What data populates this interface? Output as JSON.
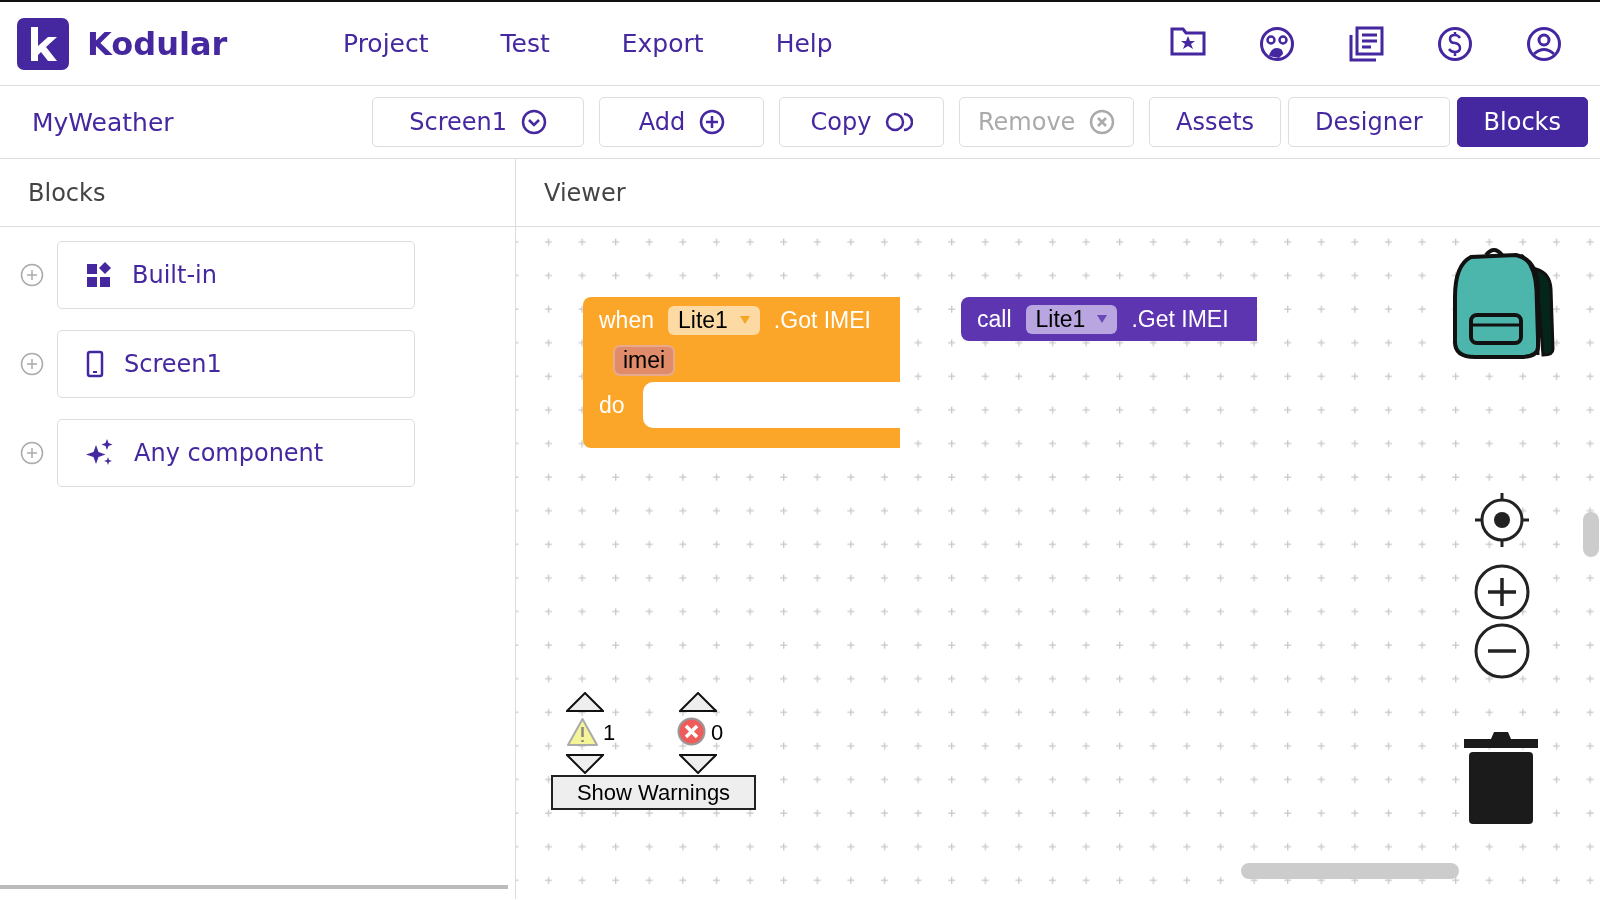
{
  "app": {
    "name": "Kodular"
  },
  "menu": [
    {
      "label": "Project"
    },
    {
      "label": "Test"
    },
    {
      "label": "Export"
    },
    {
      "label": "Help"
    }
  ],
  "project": "MyWeather",
  "actions": [
    {
      "label": "Screen1",
      "kind": "dropdown",
      "disabled": false
    },
    {
      "label": "Add",
      "kind": "add",
      "disabled": false
    },
    {
      "label": "Copy",
      "kind": "copy",
      "disabled": false
    },
    {
      "label": "Remove",
      "kind": "remove",
      "disabled": true
    }
  ],
  "views": [
    {
      "label": "Assets",
      "selected": false
    },
    {
      "label": "Designer",
      "selected": false
    },
    {
      "label": "Blocks",
      "selected": true
    }
  ],
  "sidebar": {
    "title": "Blocks",
    "items": [
      {
        "label": "Built-in",
        "kind": "builtin"
      },
      {
        "label": "Screen1",
        "kind": "screen"
      },
      {
        "label": "Any component",
        "kind": "any"
      }
    ]
  },
  "viewer": {
    "title": "Viewer",
    "blocks": [
      {
        "kind": "event",
        "keyword": "when",
        "component": "Lite1",
        "name": ".Got IMEI",
        "param": "imei",
        "body": "do"
      },
      {
        "kind": "call",
        "keyword": "call",
        "component": "Lite1",
        "name": ".Get IMEI"
      }
    ],
    "warnings": {
      "warning_count": "1",
      "error_count": "0",
      "button": "Show Warnings"
    }
  }
}
